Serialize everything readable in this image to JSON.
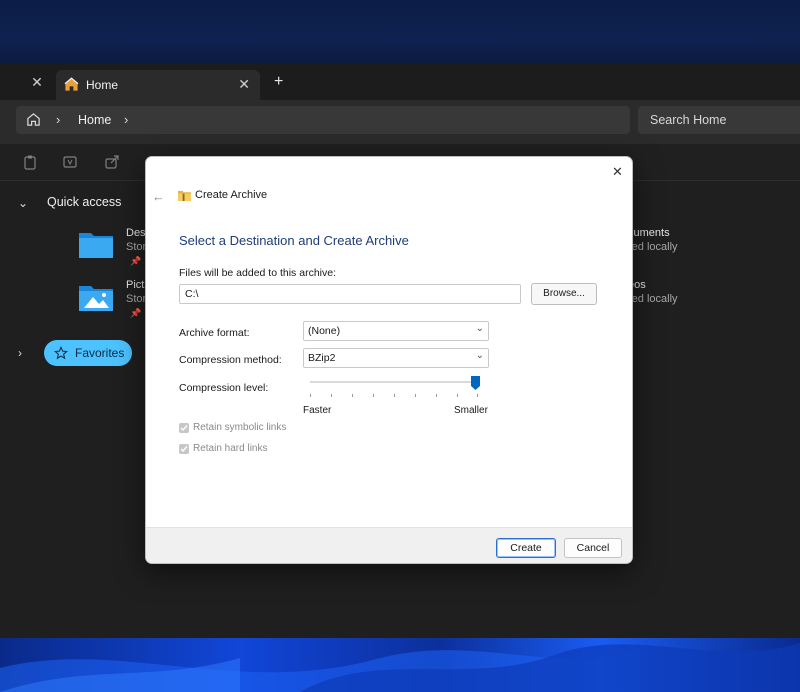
{
  "tabs": [
    {
      "label": "Home",
      "active": true
    }
  ],
  "address": {
    "crumb": "Home"
  },
  "search": {
    "placeholder": "Search Home"
  },
  "quick_access": {
    "title": "Quick access",
    "items_left": [
      {
        "name": "Desk",
        "sub": "Stor"
      },
      {
        "name": "Pictu",
        "sub": "Stor"
      }
    ],
    "items_right": [
      {
        "name": "cuments",
        "sub": "red locally"
      },
      {
        "name": "eos",
        "sub": "red locally"
      }
    ]
  },
  "favorites": {
    "label": "Favorites"
  },
  "dialog": {
    "title": "Create Archive",
    "heading": "Select a Destination and Create Archive",
    "files_label": "Files will be added to this archive:",
    "path_value": "C:\\",
    "browse_label": "Browse...",
    "archive_format_label": "Archive format:",
    "archive_format_value": "(None)",
    "compression_method_label": "Compression method:",
    "compression_method_value": "BZip2",
    "compression_level_label": "Compression level:",
    "compression_level": 1.0,
    "faster_label": "Faster",
    "smaller_label": "Smaller",
    "retain_symlinks_label": "Retain symbolic links",
    "retain_symlinks_checked": true,
    "retain_hardlinks_label": "Retain hard links",
    "retain_hardlinks_checked": true,
    "create_label": "Create",
    "cancel_label": "Cancel"
  },
  "colors": {
    "accent": "#4cc2ff",
    "heading": "#1f3d7a",
    "slider": "#0067c0"
  }
}
